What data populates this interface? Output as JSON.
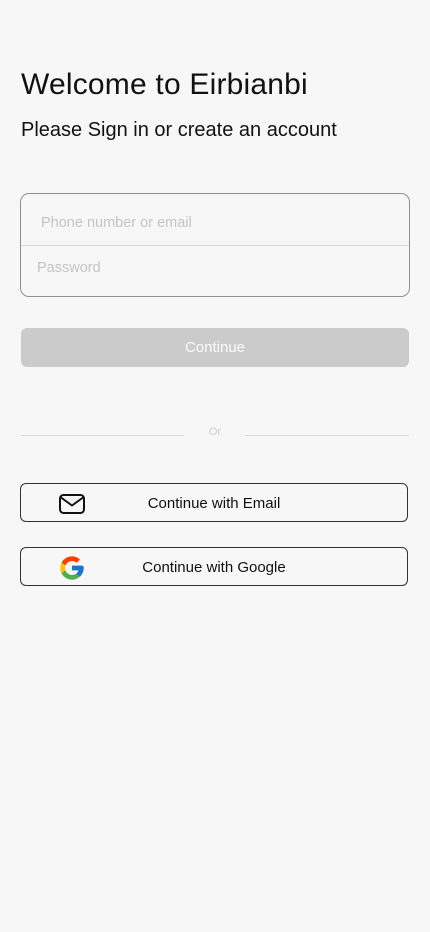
{
  "header": {
    "title": "Welcome to Eirbianbi",
    "subtitle": "Please Sign in or create an account"
  },
  "form": {
    "phone_placeholder": "Phone number or email",
    "phone_value": "",
    "password_placeholder": "Password",
    "password_value": "",
    "continue_label": "Continue",
    "continue_bg": "#cbcbcb"
  },
  "divider": {
    "or_label": "Or"
  },
  "social": {
    "email_label": "Continue with Email",
    "email_icon": "mail-icon",
    "google_label": "Continue with Google",
    "google_icon": "google-logo-icon",
    "google_colors": [
      "#4285F4",
      "#34A853",
      "#FBBC05",
      "#EA4335"
    ]
  }
}
